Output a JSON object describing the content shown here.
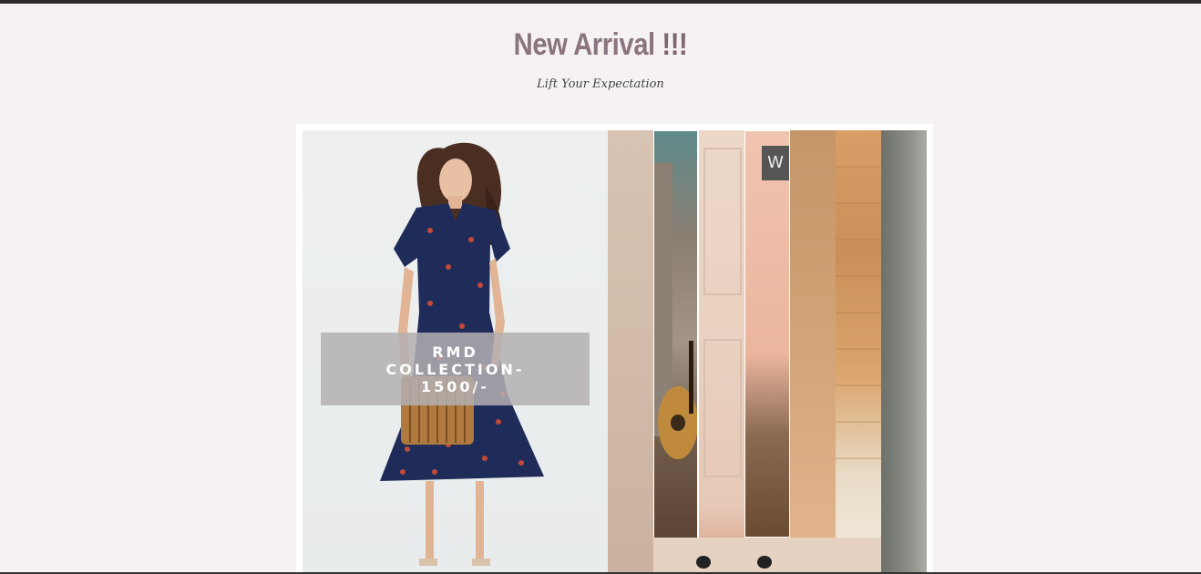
{
  "section": {
    "title": "New Arrival",
    "title_emphasis": "!!!",
    "subtitle": "Lift Your Expectation"
  },
  "slider": {
    "active_slide": {
      "caption": "RMD COLLECTION-1500/-"
    },
    "brand_badge": "W"
  },
  "colors": {
    "background": "#f6f2f2",
    "title": "#8a7480",
    "caption_overlay": "#b4afb2"
  }
}
